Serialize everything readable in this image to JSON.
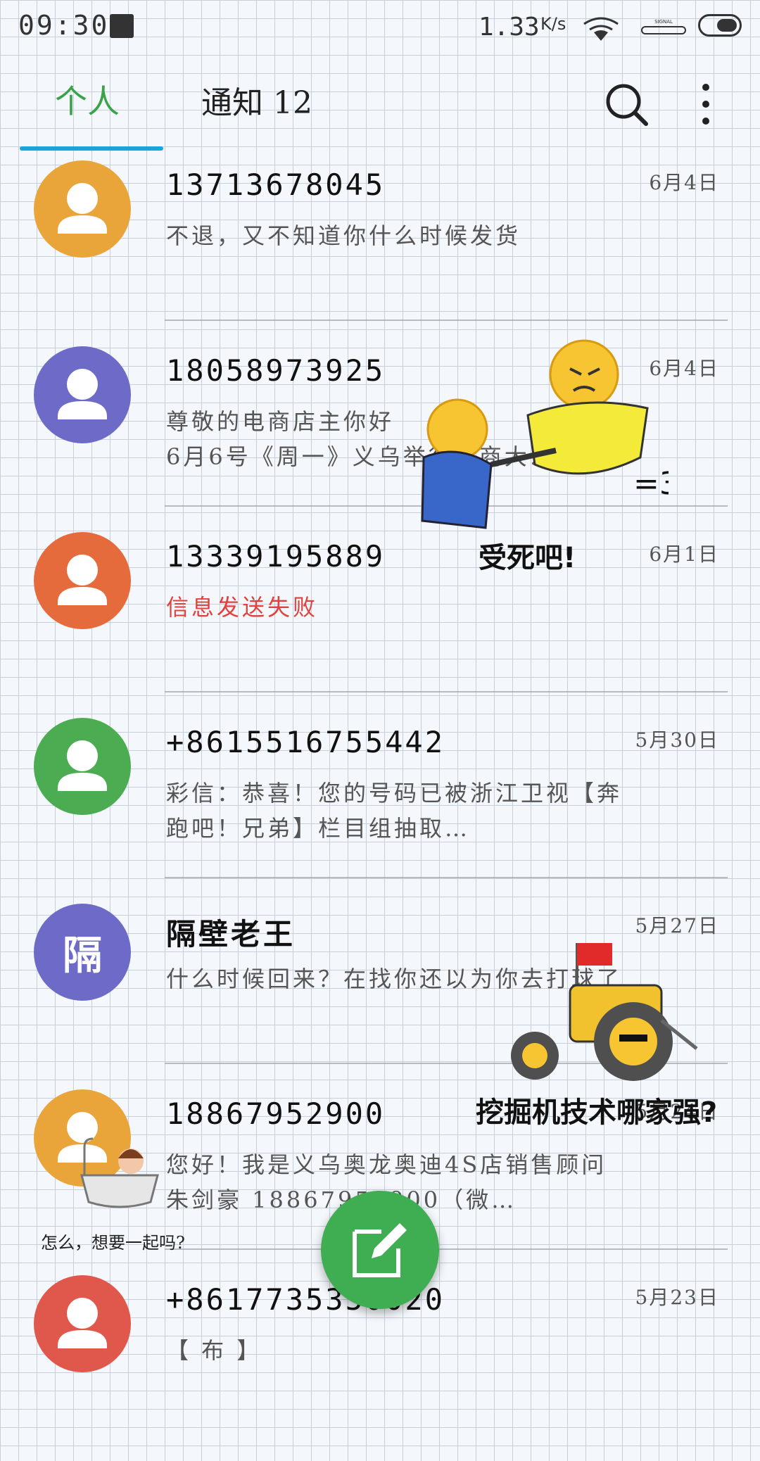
{
  "status_bar": {
    "time": "09:30",
    "net_speed": "1.33",
    "net_speed_unit": "K/s",
    "signal_label": "SIGNAL"
  },
  "tabs": [
    {
      "label": "个人",
      "active": true
    },
    {
      "label": "通知 12",
      "active": false
    }
  ],
  "colors": {
    "active_tab": "#3aa34a",
    "tab_indicator": "#1aa4dd",
    "fab": "#3fad52",
    "error_text": "#e0413b"
  },
  "conversations": [
    {
      "sender": "13713678045",
      "date": "6月4日",
      "preview": "不退，又不知道你什么时候发货",
      "avatar_color": "#e9a43a",
      "avatar_letter": "",
      "failed": false
    },
    {
      "sender": "18058973925",
      "date": "6月4日",
      "preview": "尊敬的电商店主你好\n6月6号《周一》义乌举行电商大…",
      "avatar_color": "#6d6bc7",
      "avatar_letter": "",
      "failed": false
    },
    {
      "sender": "13339195889",
      "date": "6月1日",
      "preview": "信息发送失败",
      "avatar_color": "#e56b3c",
      "avatar_letter": "",
      "failed": true
    },
    {
      "sender": "+8615516755442",
      "date": "5月30日",
      "preview": "彩信：恭喜！您的号码已被浙江卫视【奔跑吧！兄弟】栏目组抽取…",
      "avatar_color": "#4bac52",
      "avatar_letter": "",
      "failed": false
    },
    {
      "sender": "隔壁老王",
      "date": "5月27日",
      "preview": "什么时候回来？在找你还以为你去打球了",
      "avatar_color": "#6d6bc7",
      "avatar_letter": "隔",
      "failed": false
    },
    {
      "sender": "18867952900",
      "date": "5月24日",
      "preview": "您好！我是义乌奥龙奥迪4S店销售顾问朱剑豪 18867952900（微…",
      "avatar_color": "#e9a43a",
      "avatar_letter": "",
      "failed": false
    },
    {
      "sender": "+8617735350020",
      "date": "5月23日",
      "preview": "【 布 】",
      "avatar_color": "#e0574b",
      "avatar_letter": "",
      "failed": false
    }
  ],
  "stickers": {
    "fight_caption": "受死吧!",
    "excavator_caption": "挖掘机技术哪家强?",
    "bath_caption": "怎么，想要一起吗?"
  },
  "icons": {
    "search": "search-icon",
    "more": "more-vertical-icon",
    "compose": "compose-icon",
    "wifi": "wifi-icon",
    "battery": "battery-icon"
  }
}
